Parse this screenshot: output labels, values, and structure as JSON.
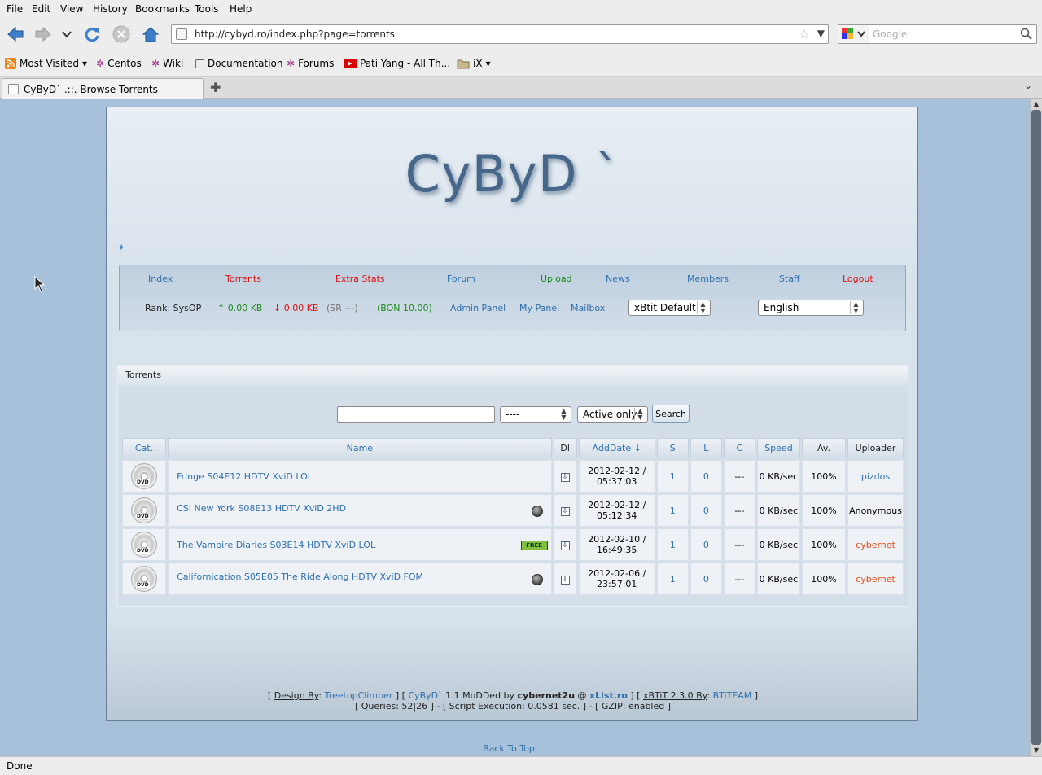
{
  "menu": [
    "File",
    "Edit",
    "View",
    "History",
    "Bookmarks",
    "Tools",
    "Help"
  ],
  "url": "http://cybyd.ro/index.php?page=torrents",
  "search_placeholder": "Google",
  "bookmarks": {
    "most_visited": "Most Visited",
    "centos": "Centos",
    "wiki": "Wiki",
    "documentation": "Documentation",
    "forums": "Forums",
    "pati": "Pati Yang - All Th...",
    "ix": "iX"
  },
  "tab_title": "CyByD` .::. Browse Torrents",
  "status": "Done",
  "site": {
    "logo": "CyByD `",
    "nav": {
      "index": "Index",
      "torrents": "Torrents",
      "extra_stats": "Extra Stats",
      "forum": "Forum",
      "upload": "Upload",
      "news": "News",
      "members": "Members",
      "staff": "Staff",
      "logout": "Logout"
    },
    "userbar": {
      "rank": "Rank: SysOP",
      "up": "↑ 0.00 KB",
      "down": "↓ 0.00 KB",
      "sr": "(SR ---)",
      "bon": "(BON 10.00)",
      "admin_panel": "Admin Panel",
      "my_panel": "My Panel",
      "mailbox": "Mailbox",
      "style_select": "xBtit Default",
      "lang_select": "English"
    },
    "torrents_box": {
      "title": "Torrents",
      "category_select": "----",
      "active_select": "Active only",
      "search_button": "Search"
    },
    "table": {
      "headers": {
        "cat": "Cat.",
        "name": "Name",
        "dl": "Dl",
        "adddate": "AddDate ↓",
        "s": "S",
        "l": "L",
        "c": "C",
        "speed": "Speed",
        "av": "Av.",
        "uploader": "Uploader"
      },
      "rows": [
        {
          "name": "Fringe S04E12 HDTV XviD LOL",
          "date1": "2012-02-12 /",
          "date2": "05:37:03",
          "s": "1",
          "l": "0",
          "c": "---",
          "speed": "0 KB/sec",
          "av": "100%",
          "uploader": "pizdos"
        },
        {
          "name": "CSI New York S08E13 HDTV XviD 2HD",
          "date1": "2012-02-12 /",
          "date2": "05:12:34",
          "s": "1",
          "l": "0",
          "c": "---",
          "speed": "0 KB/sec",
          "av": "100%",
          "uploader": "Anonymous"
        },
        {
          "name": "The Vampire Diaries S03E14 HDTV XviD LOL",
          "date1": "2012-02-10 /",
          "date2": "16:49:35",
          "s": "1",
          "l": "0",
          "c": "---",
          "speed": "0 KB/sec",
          "av": "100%",
          "uploader": "cybernet",
          "badge": "FREE"
        },
        {
          "name": "Californication S05E05 The Ride Along HDTV XviD FQM",
          "date1": "2012-02-06 /",
          "date2": "23:57:01",
          "s": "1",
          "l": "0",
          "c": "---",
          "speed": "0 KB/sec",
          "av": "100%",
          "uploader": "cybernet"
        }
      ],
      "cat_label": "DVD"
    },
    "footer": {
      "design_by": "Design By",
      "designer": "TreetopClimber",
      "cybyd": "CyByD`",
      "modded": "1.1 MoDDed by",
      "author": "cybernet2u",
      "at": "@",
      "xlist": "xList.ro",
      "xbtit": "xBTiT 2.3.0 By",
      "btiteam": "BTiTEAM",
      "line2": "[ Queries: 52|26 ] - [ Script Execution: 0.0581 sec. ] - [ GZIP: enabled ]"
    },
    "back_to_top": "Back To Top"
  },
  "colors": {
    "page_bg": "#a6c1d9",
    "link": "#2e6fae",
    "red": "#e01010",
    "green": "#1c8a1c",
    "orange": "#e4501a"
  }
}
